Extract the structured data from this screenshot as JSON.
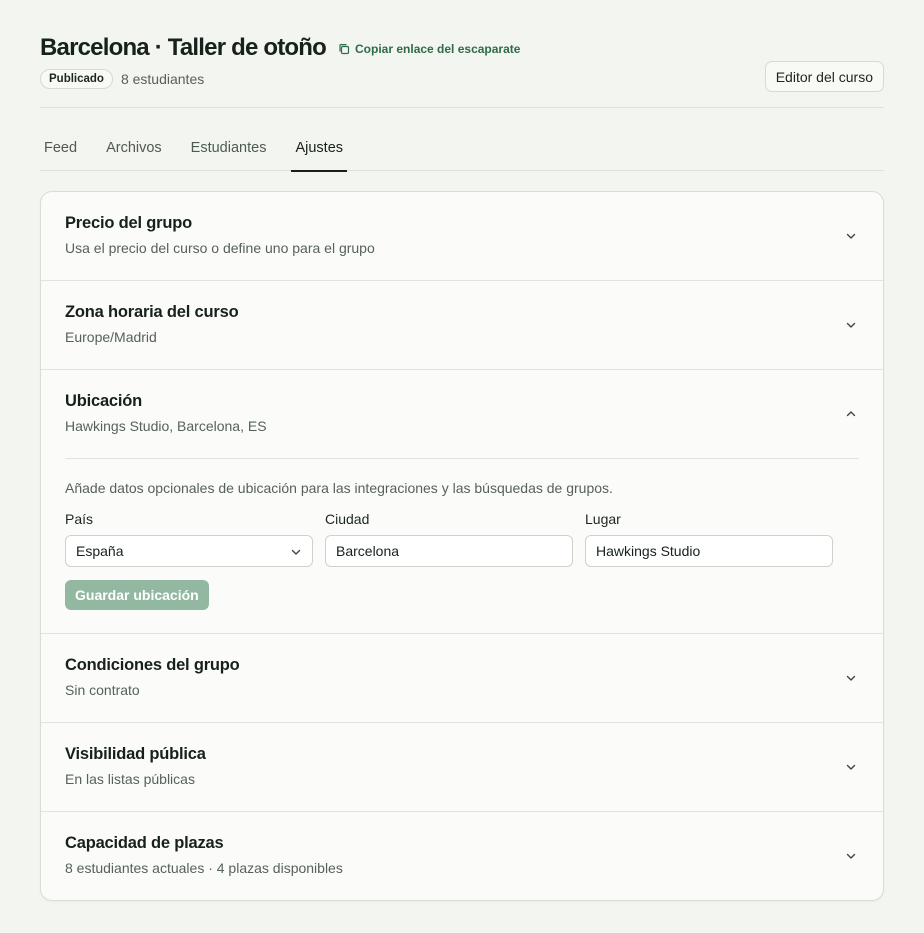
{
  "header": {
    "title": "Barcelona · Taller de otoño",
    "copy_link_label": "Copiar enlace del escaparate",
    "status_badge": "Publicado",
    "students_count": "8 estudiantes",
    "editor_button": "Editor del curso"
  },
  "tabs": [
    {
      "label": "Feed",
      "active": false
    },
    {
      "label": "Archivos",
      "active": false
    },
    {
      "label": "Estudiantes",
      "active": false
    },
    {
      "label": "Ajustes",
      "active": true
    }
  ],
  "sections": {
    "price": {
      "title": "Precio del grupo",
      "subtitle": "Usa el precio del curso o define uno para el grupo",
      "expanded": false
    },
    "timezone": {
      "title": "Zona horaria del curso",
      "subtitle": "Europe/Madrid",
      "expanded": false
    },
    "location": {
      "title": "Ubicación",
      "subtitle": "Hawkings Studio, Barcelona, ES",
      "expanded": true,
      "help_text": "Añade datos opcionales de ubicación para las integraciones y las búsquedas de grupos.",
      "country_label": "País",
      "country_value": "España",
      "city_label": "Ciudad",
      "city_value": "Barcelona",
      "venue_label": "Lugar",
      "venue_value": "Hawkings Studio",
      "save_button": "Guardar ubicación"
    },
    "conditions": {
      "title": "Condiciones del grupo",
      "subtitle": "Sin contrato",
      "expanded": false
    },
    "visibility": {
      "title": "Visibilidad pública",
      "subtitle": "En las listas públicas",
      "expanded": false
    },
    "capacity": {
      "title": "Capacidad de plazas",
      "subtitle": "8 estudiantes actuales · 4 plazas disponibles",
      "expanded": false
    }
  },
  "icons": {
    "copy": "copy-icon",
    "chevron_down": "chevron-down-icon",
    "chevron_up": "chevron-up-icon"
  },
  "colors": {
    "accent": "#2f6a49",
    "save_button_disabled": "#93b8a2",
    "background": "#f3f5f0"
  }
}
